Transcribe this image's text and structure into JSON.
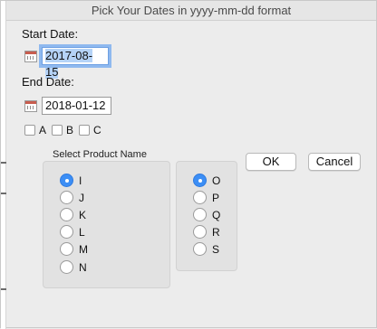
{
  "window": {
    "title": "Pick Your Dates in yyyy-mm-dd format"
  },
  "dates": {
    "start_label": "Start Date:",
    "start_value": "2017-08-15",
    "end_label": "End Date:",
    "end_value": "2018-01-12"
  },
  "checkboxes": [
    {
      "label": "A",
      "checked": false
    },
    {
      "label": "B",
      "checked": false
    },
    {
      "label": "C",
      "checked": false
    }
  ],
  "product_group": {
    "title": "Select Product Name",
    "left_options": [
      "I",
      "J",
      "K",
      "L",
      "M",
      "N"
    ],
    "right_options": [
      "O",
      "P",
      "Q",
      "R",
      "S"
    ],
    "selected_left": "I",
    "selected_right": "O"
  },
  "buttons": {
    "ok": "OK",
    "cancel": "Cancel"
  },
  "icons": {
    "calendar": "calendar-icon",
    "radio_selected_color": "#3c8ef5"
  }
}
